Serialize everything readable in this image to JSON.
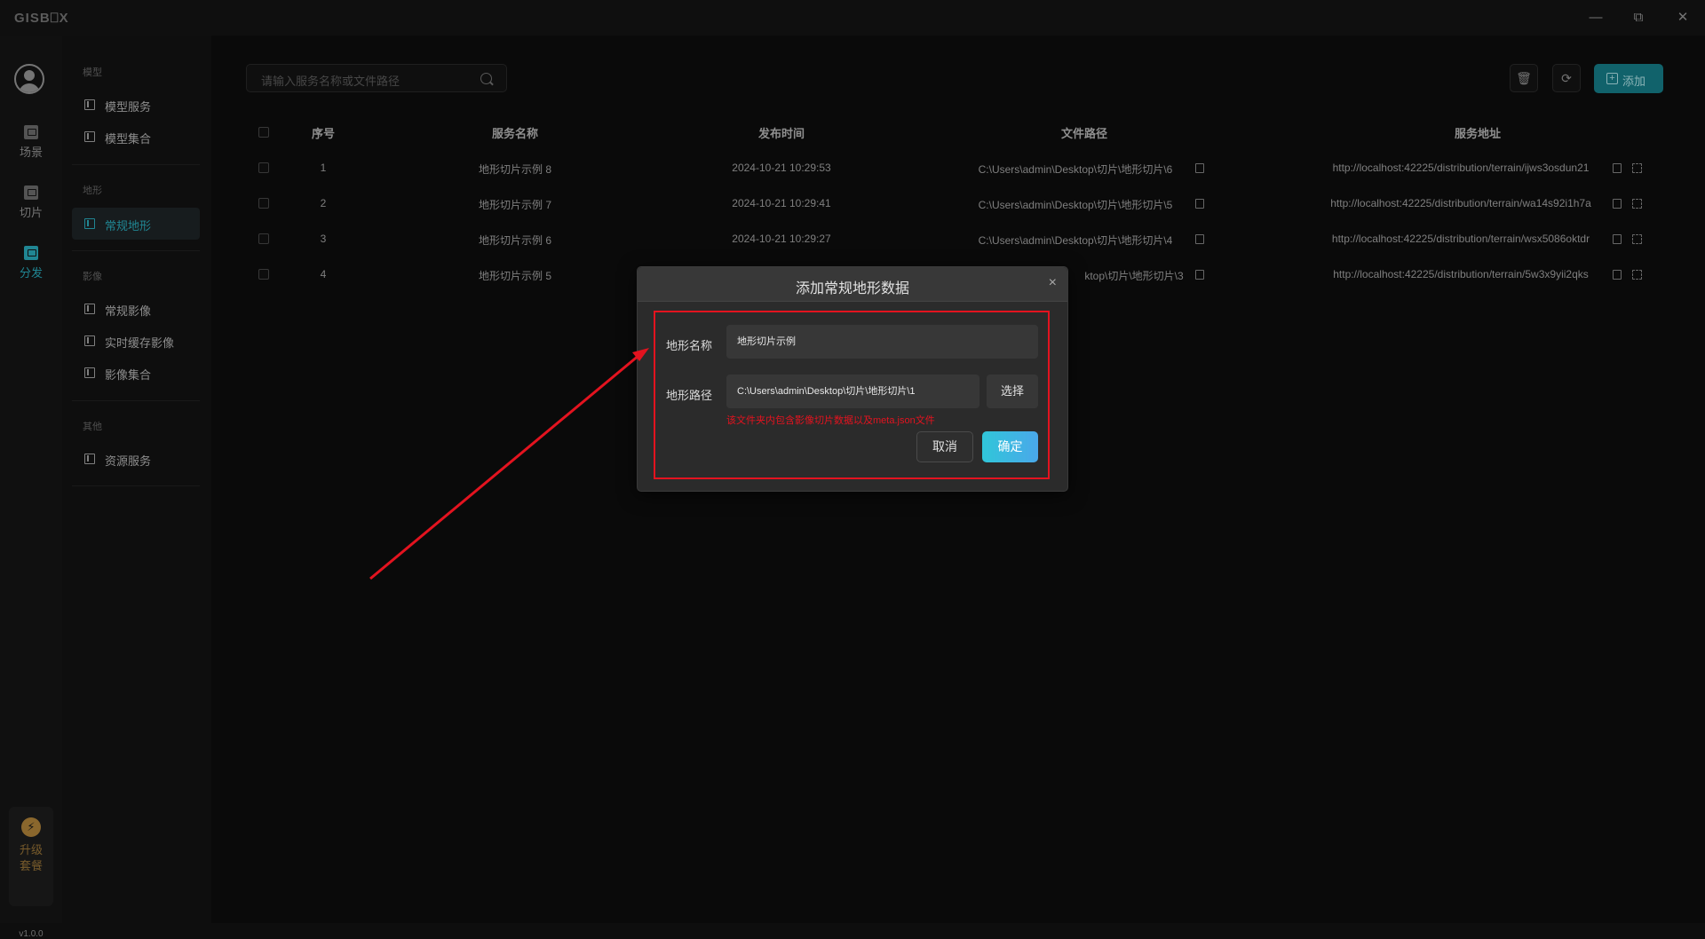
{
  "app": {
    "logo": "GISB⎕X"
  },
  "window": {
    "minimize": "—",
    "restore": "⧉",
    "close": "✕"
  },
  "rail": {
    "items": [
      {
        "label": "场景",
        "icon": "scene-icon"
      },
      {
        "label": "切片",
        "icon": "slice-icon"
      },
      {
        "label": "分发",
        "icon": "distribute-icon",
        "active": true
      }
    ],
    "upgrade": {
      "line1": "升级",
      "line2": "套餐",
      "icon": "bolt-icon"
    },
    "version": "v1.0.0"
  },
  "subnav": {
    "groups": [
      {
        "title": "模型",
        "items": [
          "模型服务",
          "模型集合"
        ]
      },
      {
        "title": "地形",
        "items": [
          "常规地形"
        ]
      },
      {
        "title": "影像",
        "items": [
          "常规影像",
          "实时缓存影像",
          "影像集合"
        ]
      },
      {
        "title": "其他",
        "items": [
          "资源服务"
        ]
      }
    ],
    "active": "常规地形"
  },
  "toolbar": {
    "search_placeholder": "请输入服务名称或文件路径",
    "add_label": "添加"
  },
  "table": {
    "headers": [
      "序号",
      "服务名称",
      "发布时间",
      "文件路径",
      "服务地址"
    ],
    "rows": [
      {
        "index": "1",
        "name": "地形切片示例 8",
        "time": "2024-10-21 10:29:53",
        "path": "C:\\Users\\admin\\Desktop\\切片\\地形切片\\6",
        "url": "http://localhost:42225/distribution/terrain/ijws3osdun21"
      },
      {
        "index": "2",
        "name": "地形切片示例 7",
        "time": "2024-10-21 10:29:41",
        "path": "C:\\Users\\admin\\Desktop\\切片\\地形切片\\5",
        "url": "http://localhost:42225/distribution/terrain/wa14s92i1h7a"
      },
      {
        "index": "3",
        "name": "地形切片示例 6",
        "time": "2024-10-21 10:29:27",
        "path": "C:\\Users\\admin\\Desktop\\切片\\地形切片\\4",
        "url": "http://localhost:42225/distribution/terrain/wsx5086oktdr"
      },
      {
        "index": "4",
        "name": "地形切片示例 5",
        "time": "",
        "path": "ktop\\切片\\地形切片\\3",
        "url": "http://localhost:42225/distribution/terrain/5w3x9yii2qks"
      }
    ]
  },
  "modal": {
    "title": "添加常规地形数据",
    "close": "×",
    "name_label": "地形名称",
    "name_value": "地形切片示例",
    "path_label": "地形路径",
    "path_value": "C:\\Users\\admin\\Desktop\\切片\\地形切片\\1",
    "select_label": "选择",
    "hint": "该文件夹内包含影像切片数据以及meta.json文件",
    "cancel_label": "取消",
    "ok_label": "确定"
  },
  "colors": {
    "accent": "#2bb3c5",
    "highlight": "#e3131f",
    "add_button": "#17838f"
  }
}
